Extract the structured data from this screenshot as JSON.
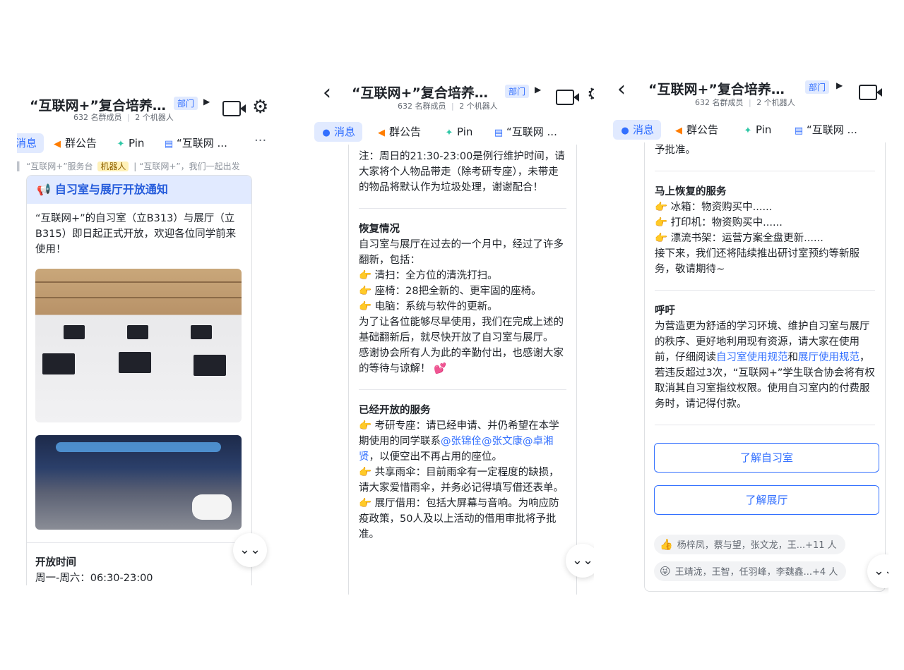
{
  "header": {
    "title": "“互联网+”复合培养…",
    "dept_badge": "部门",
    "members": "632 名群成员",
    "separator": "|",
    "bots": "2 个机器人"
  },
  "tabs": {
    "messages": "消息",
    "messages_partial": "消息",
    "announcement": "群公告",
    "pin": "Pin",
    "doc": "“互联网 ...",
    "more": "···"
  },
  "icons": {
    "back": "chevron-left-icon",
    "video": "video-camera-icon",
    "settings": "gear-icon",
    "messages": "chat-bubble-icon",
    "announcement": "megaphone-icon",
    "pin": "pin-icon",
    "doc": "document-icon",
    "scroll_down": "double-chevron-down-icon"
  },
  "colors": {
    "accent": "#3370ff",
    "card_head_bg": "#e1eaff",
    "bot_badge_bg": "#fff1b8"
  },
  "panel1": {
    "pinned_bar": {
      "source": "“互联网+”服务台",
      "bot_badge": "机器人",
      "sep": "|",
      "preview": "“互联网+”，我们一起出发"
    },
    "card_title": "自习室与展厅开放通知",
    "intro": "“互联网+”的自习室（立B313）与展厅（立B315）即日起正式开放，欢迎各位同学前来使用！",
    "open_time_heading": "开放时间",
    "open_time_line": "周一-周六：06:30-23:00"
  },
  "panel2": {
    "note": "注：周日的21:30-23:00是例行维护时间，请大家将个人物品带走（除考研专座），未带走的物品将默认作为垃圾处理，谢谢配合！",
    "recovery_heading": "恢复情况",
    "recovery_intro": "自习室与展厅在过去的一个月中，经过了许多翻新，包括：",
    "recovery_items": [
      "清扫：全方位的清洗打扫。",
      "座椅：28把全新的、更牢固的座椅。",
      "电脑：系统与软件的更新。"
    ],
    "recovery_p1": "为了让各位能够尽早使用，我们在完成上述的基础翻新后，就尽快开放了自习室与展厅。",
    "recovery_p2": "感谢协会所有人为此的辛勤付出，也感谢大家的等待与谅解！",
    "heart": "💕",
    "opened_heading": "已经开放的服务",
    "service1_pre": "考研专座：请已经申请、并仍希望在本学期使用的同学联系",
    "mentions": [
      "@张锦佺",
      "@张文康",
      "@卓湘贤"
    ],
    "service1_post": "，以便空出不再占用的座位。",
    "service2": "共享雨伞：目前雨伞有一定程度的缺损，请大家爱惜雨伞，并务必记得填写借还表单。",
    "service3": "展厅借用：包括大屏幕与音响。为响应防疫政策，50人及以上活动的借用审批将予批准。"
  },
  "panel3": {
    "top_partial": "予批准。",
    "resume_heading": "马上恢复的服务",
    "resume_items": [
      "冰箱：物资购买中......",
      "打印机：物资购买中......",
      "漂流书架：运营方案全盘更新......"
    ],
    "resume_after": "接下来，我们还将陆续推出研讨室预约等新服务，敬请期待~",
    "appeal_heading": "呼吁",
    "appeal_pre": "为营造更为舒适的学习环境、维护自习室与展厅的秩序、更好地利用现有资源，请大家在使用前，仔细阅读",
    "link1": "自习室使用规范",
    "and": "和",
    "link2": "展厅使用规范",
    "appeal_post": "，若违反超过3次，“互联网+”学生联合协会将有权取消其自习室指纹权限。使用自习室内的付费服务时，请记得付款。",
    "btn_room": "了解自习室",
    "btn_hall": "了解展厅",
    "reaction1": "杨梓凤，蔡与望，张文龙，王...+11 人",
    "reaction2": "王靖泷，王智，任羽峰，李魏鑫...+4 人"
  }
}
